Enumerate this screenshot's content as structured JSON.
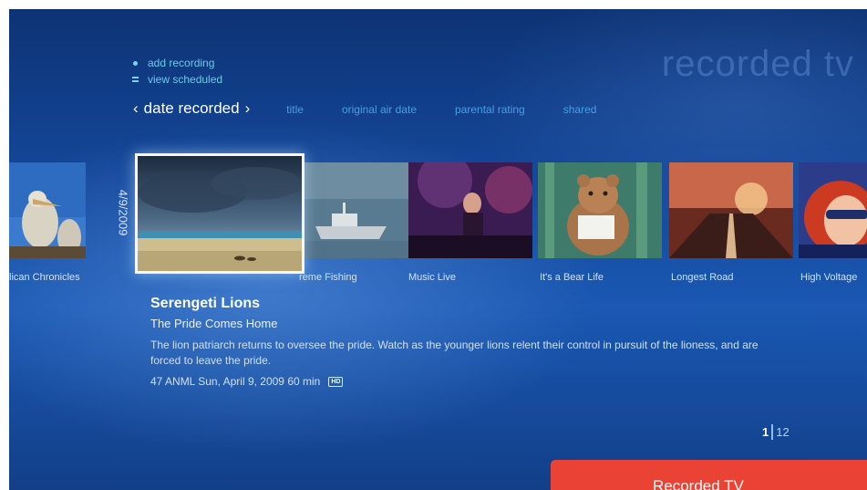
{
  "app_title": "recorded tv",
  "tasks": [
    {
      "label": "add recording",
      "icon": "bullet-dot-icon"
    },
    {
      "label": "view scheduled",
      "icon": "list-lines-icon"
    }
  ],
  "sort": {
    "current": "date recorded",
    "options": [
      "title",
      "original air date",
      "parental rating",
      "shared"
    ]
  },
  "date_group": "4/9/2009",
  "recordings": [
    {
      "caption": "Pelican Chronicles",
      "visible_caption": "lican Chronicles"
    },
    {
      "caption": "Serengeti Lions",
      "visible_caption": ""
    },
    {
      "caption": "Extreme Fishing",
      "visible_caption": "reme Fishing"
    },
    {
      "caption": "Music Live",
      "visible_caption": "Music Live"
    },
    {
      "caption": "It's a Bear Life",
      "visible_caption": "It's a Bear Life"
    },
    {
      "caption": "Longest Road",
      "visible_caption": "Longest Road"
    },
    {
      "caption": "High Voltage",
      "visible_caption": "High Voltage"
    }
  ],
  "details": {
    "title": "Serengeti Lions",
    "subtitle": "The Pride Comes Home",
    "description": "The lion patriarch returns to oversee the pride. Watch as the younger lions relent their control in pursuit of the lioness, and are forced to leave the pride.",
    "meta": "47 ANML Sun, April 9, 2009  60 min",
    "badge": "HD"
  },
  "pager": {
    "current": "1",
    "total": "12"
  },
  "toast": {
    "label": "Recorded TV"
  },
  "colors": {
    "accent": "#6fc9e9",
    "toast": "#ea4335",
    "background": "#14479a"
  }
}
